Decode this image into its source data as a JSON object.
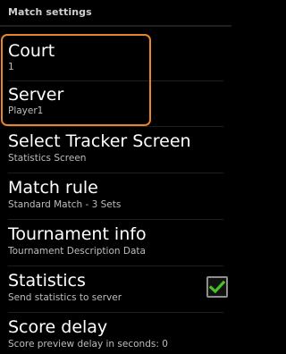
{
  "header": {
    "title": "Match settings"
  },
  "settings": [
    {
      "title": "Court",
      "subtitle": "1"
    },
    {
      "title": "Server",
      "subtitle": "Player1"
    },
    {
      "title": "Select Tracker Screen",
      "subtitle": "Statistics Screen"
    },
    {
      "title": "Match rule",
      "subtitle": "Standard Match - 3 Sets"
    },
    {
      "title": "Tournament info",
      "subtitle": "Tournament Description Data"
    },
    {
      "title": "Statistics",
      "subtitle": "Send statistics to server",
      "checked": true
    },
    {
      "title": "Score delay",
      "subtitle": "Score preview delay in seconds: 0"
    }
  ],
  "colors": {
    "highlight": "#e8852a",
    "check": "#49c11f"
  }
}
